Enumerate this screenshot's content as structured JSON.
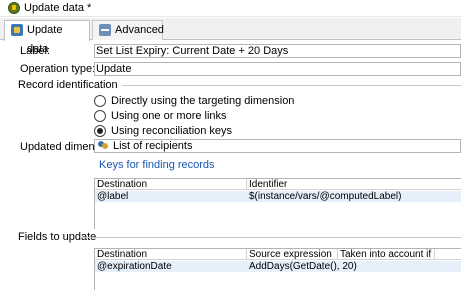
{
  "window": {
    "title": "Update data *"
  },
  "tabs": [
    {
      "label": "Update data",
      "icon": "update-data-icon"
    },
    {
      "label": "Advanced",
      "icon": "advanced-icon"
    }
  ],
  "form": {
    "label_caption": "Label:",
    "label_value": "Set List Expiry: Current Date + 20 Days",
    "operation_caption": "Operation type:",
    "operation_value": "Update"
  },
  "record_identification": {
    "title": "Record identification",
    "options": [
      {
        "label": "Directly using the targeting dimension",
        "checked": false
      },
      {
        "label": "Using one or more links",
        "checked": false
      },
      {
        "label": "Using reconciliation keys",
        "checked": true
      }
    ],
    "dimension_caption": "Updated dimension:",
    "dimension_value": "List of recipients",
    "keys_link": "Keys for finding records",
    "keys_table": {
      "headers": [
        "Destination",
        "Identifier"
      ],
      "rows": [
        [
          "@label",
          "$(instance/vars/@computedLabel)"
        ]
      ]
    }
  },
  "fields_to_update": {
    "title": "Fields to update",
    "table": {
      "headers": [
        "Destination",
        "Source expression",
        "Taken into account if"
      ],
      "rows": [
        [
          "@expirationDate",
          "AddDays(GetDate(), 20)",
          ""
        ]
      ]
    }
  }
}
